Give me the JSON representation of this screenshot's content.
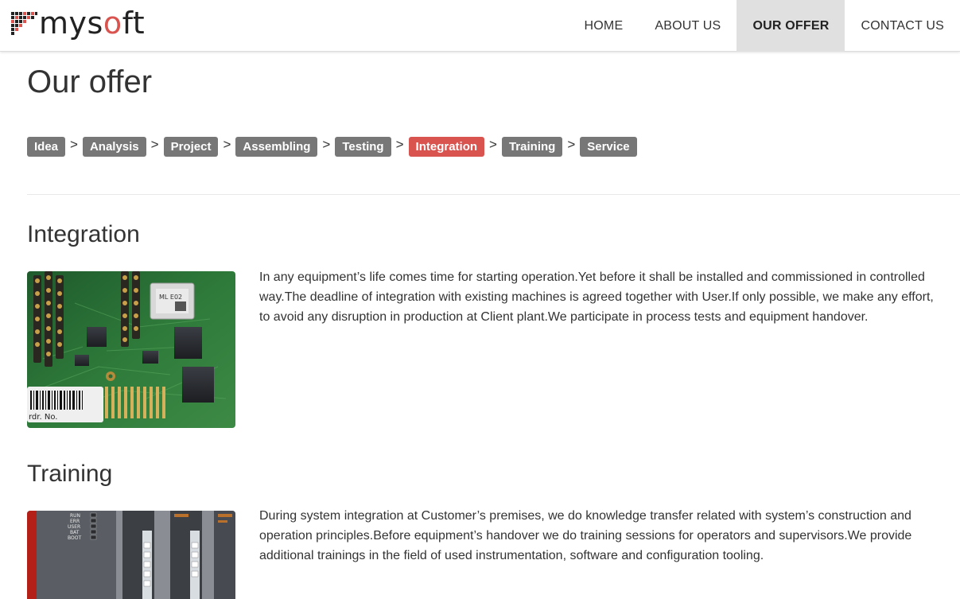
{
  "brand": {
    "name_prefix": "mys",
    "name_accent": "o",
    "name_suffix": "ft",
    "accent_color": "#d9534f"
  },
  "nav": {
    "items": [
      {
        "label": "HOME",
        "active": false
      },
      {
        "label": "ABOUT US",
        "active": false
      },
      {
        "label": "OUR OFFER",
        "active": true
      },
      {
        "label": "CONTACT US",
        "active": false
      }
    ]
  },
  "page": {
    "title": "Our offer"
  },
  "steps": {
    "separator": ">",
    "items": [
      {
        "label": "Idea",
        "active": false
      },
      {
        "label": "Analysis",
        "active": false
      },
      {
        "label": "Project",
        "active": false
      },
      {
        "label": "Assembling",
        "active": false
      },
      {
        "label": "Testing",
        "active": false
      },
      {
        "label": "Integration",
        "active": true
      },
      {
        "label": "Training",
        "active": false
      },
      {
        "label": "Service",
        "active": false
      }
    ],
    "colors": {
      "default": "#777777",
      "active": "#d9534f"
    }
  },
  "sections": [
    {
      "title": "Integration",
      "image": "circuit-board-photo",
      "image_label": "rdr. No.",
      "text": "In any equipment’s life comes time for starting operation.Yet before it shall be installed and commissioned in controlled way.The deadline of integration with existing machines is agreed together with User.If only possible, we make any effort, to avoid any disruption in production at Client plant.We participate in process tests and equipment handover."
    },
    {
      "title": "Training",
      "image": "plc-controller-photo",
      "image_leds": [
        "RUN",
        "ERR",
        "USER",
        "BAT",
        "BOOT"
      ],
      "text": "During system integration at Customer’s premises, we do knowledge transfer related with system’s construction and operation principles.Before equipment’s handover we do training sessions for operators and supervisors.We provide additional trainings in the field of used instrumentation, software and configuration tooling."
    }
  ]
}
